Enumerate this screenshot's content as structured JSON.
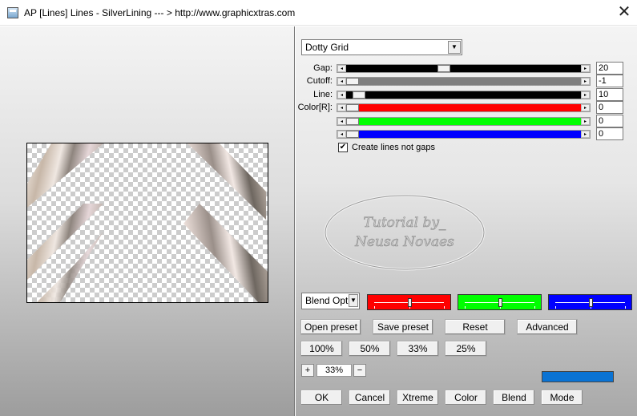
{
  "window": {
    "title": "AP [Lines]  Lines - SilverLining    --- > http://www.graphicxtras.com",
    "close_glyph": "✕"
  },
  "preset_dropdown": {
    "value": "Dotty Grid"
  },
  "params": [
    {
      "label": "Gap:",
      "value": "20",
      "fraction": 0.41,
      "color": "#000000"
    },
    {
      "label": "Cutoff:",
      "value": "-1",
      "fraction": 0.0,
      "color": "#808080"
    },
    {
      "label": "Line:",
      "value": "10",
      "fraction": 0.03,
      "color": "#000000"
    },
    {
      "label": "Color[R]:",
      "value": "0",
      "fraction": 0.0,
      "color": "#ff0000"
    },
    {
      "label": "",
      "value": "0",
      "fraction": 0.0,
      "color": "#00ff00"
    },
    {
      "label": "",
      "value": "0",
      "fraction": 0.0,
      "color": "#0000ff"
    }
  ],
  "create_lines": {
    "label": "Create lines not gaps",
    "checked": true,
    "check_glyph": "✔"
  },
  "watermark": {
    "line1": "Tutorial by_",
    "line2": "Neusa Novaes"
  },
  "blend_dropdown": {
    "value": "Blend Optio"
  },
  "color_sliders": [
    {
      "name": "red",
      "color": "#ff0000",
      "fraction": 0.5
    },
    {
      "name": "green",
      "color": "#00ff00",
      "fraction": 0.5
    },
    {
      "name": "blue",
      "color": "#0000ff",
      "fraction": 0.5
    }
  ],
  "buttons_row1": [
    "Open preset",
    "Save preset",
    "Reset",
    "Advanced"
  ],
  "zoom_buttons": [
    "100%",
    "50%",
    "33%",
    "25%"
  ],
  "zoom": {
    "plus": "+",
    "value": "33%",
    "minus": "−"
  },
  "accent_color": "#0a73d4",
  "bottom_buttons": [
    "OK",
    "Cancel",
    "Xtreme",
    "Color",
    "Blend",
    "Mode"
  ],
  "icons": {
    "step_left": "◂",
    "step_right": "▸",
    "dropdown_arrow": "▼"
  }
}
